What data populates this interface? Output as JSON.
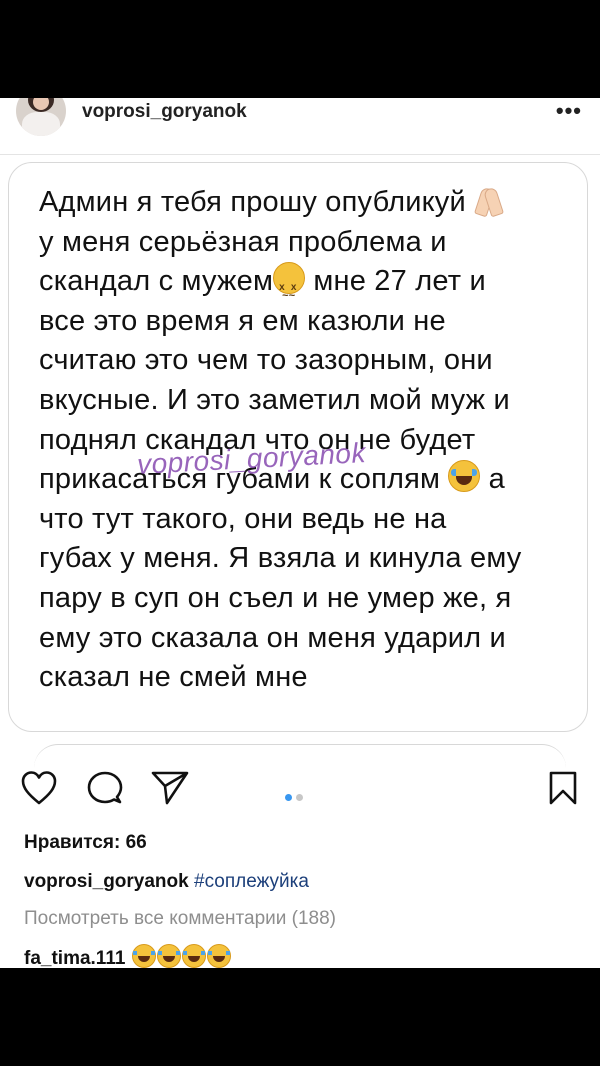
{
  "header": {
    "username": "voprosi_goryanok",
    "more_icon": "more-horizontal-icon"
  },
  "post": {
    "lines": [
      "Админ я тебя прошу опубликуй",
      "у меня серьёзная проблема и",
      "скандал с мужем",
      " мне 27 лет и",
      "все это время я ем казюли не",
      "считаю это чем то зазорным, они",
      "вкусные. И это заметил мой муж и",
      "поднял скандал что он не будет",
      "прикасаться губами к соплям ",
      " а",
      "что тут такого, они ведь не на",
      "губах у меня. Я взяла и кинула ему",
      "пару в суп он съел и не умер же, я",
      "ему это сказала он меня ударил и",
      "сказал не смей мне"
    ],
    "watermark": "voprosi_goryanok"
  },
  "actions": {
    "like_icon": "heart-icon",
    "comment_icon": "comment-icon",
    "share_icon": "send-icon",
    "save_icon": "bookmark-icon",
    "carousel_active": "#3897f0",
    "carousel_inactive": "#c7c7c7"
  },
  "likes": {
    "label": "Нравится: 66"
  },
  "caption": {
    "username": "voprosi_goryanok",
    "hashtag": "#соплежуйка"
  },
  "comments": {
    "view_all": "Посмотреть все комментарии (188)",
    "first_user": "fa_tima.111"
  }
}
